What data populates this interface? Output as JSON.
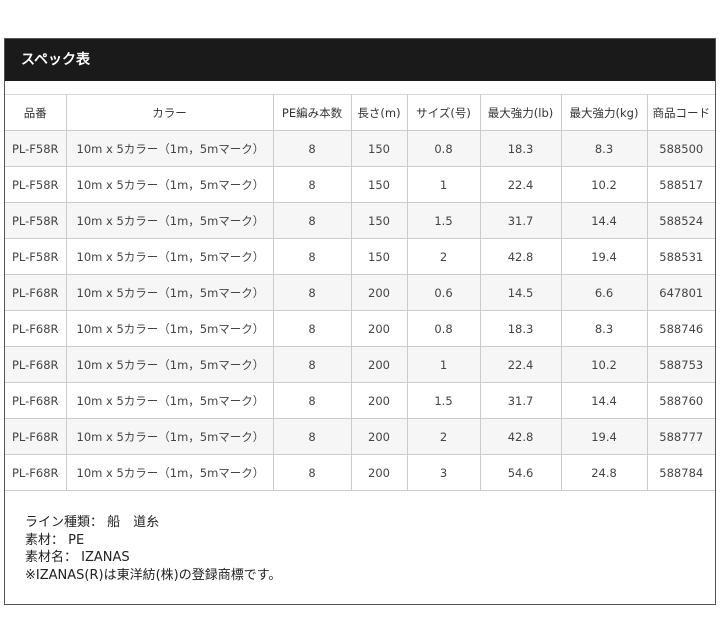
{
  "section": {
    "title": "スペック表"
  },
  "table": {
    "headers": [
      "品番",
      "カラー",
      "PE編み本数",
      "長さ(m)",
      "サイズ(号)",
      "最大強力(lb)",
      "最大強力(kg)",
      "商品コード"
    ],
    "rows": [
      [
        "PL-F58R",
        "10m x 5カラー（1m，5mマーク）",
        "8",
        "150",
        "0.8",
        "18.3",
        "8.3",
        "588500"
      ],
      [
        "PL-F58R",
        "10m x 5カラー（1m，5mマーク）",
        "8",
        "150",
        "1",
        "22.4",
        "10.2",
        "588517"
      ],
      [
        "PL-F58R",
        "10m x 5カラー（1m，5mマーク）",
        "8",
        "150",
        "1.5",
        "31.7",
        "14.4",
        "588524"
      ],
      [
        "PL-F58R",
        "10m x 5カラー（1m，5mマーク）",
        "8",
        "150",
        "2",
        "42.8",
        "19.4",
        "588531"
      ],
      [
        "PL-F68R",
        "10m x 5カラー（1m，5mマーク）",
        "8",
        "200",
        "0.6",
        "14.5",
        "6.6",
        "647801"
      ],
      [
        "PL-F68R",
        "10m x 5カラー（1m，5mマーク）",
        "8",
        "200",
        "0.8",
        "18.3",
        "8.3",
        "588746"
      ],
      [
        "PL-F68R",
        "10m x 5カラー（1m，5mマーク）",
        "8",
        "200",
        "1",
        "22.4",
        "10.2",
        "588753"
      ],
      [
        "PL-F68R",
        "10m x 5カラー（1m，5mマーク）",
        "8",
        "200",
        "1.5",
        "31.7",
        "14.4",
        "588760"
      ],
      [
        "PL-F68R",
        "10m x 5カラー（1m，5mマーク）",
        "8",
        "200",
        "2",
        "42.8",
        "19.4",
        "588777"
      ],
      [
        "PL-F68R",
        "10m x 5カラー（1m，5mマーク）",
        "8",
        "200",
        "3",
        "54.6",
        "24.8",
        "588784"
      ]
    ]
  },
  "notes": [
    "ライン種類： 船　道糸",
    "素材： PE",
    "素材名： IZANAS",
    "※IZANAS(R)は東洋紡(株)の登録商標です。"
  ],
  "colors": {
    "header_bg": "#1a1a1a",
    "header_text": "#ffffff",
    "row_stripe": "#f6f6f6",
    "border": "#cccccc"
  }
}
